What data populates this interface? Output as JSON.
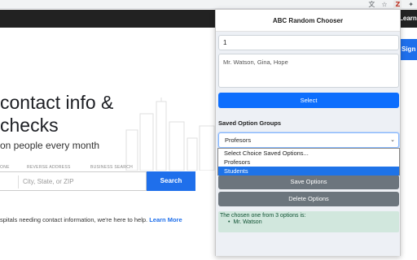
{
  "browser": {
    "translate_icon": "translate-icon",
    "star_icon": "bookmark-star-icon",
    "extension_icon": "extension-icon",
    "puzzle_icon": "extensions-puzzle-icon"
  },
  "site": {
    "nav_learn": "Learn M",
    "sign_button": "Sign",
    "hero_line1": "contact info &",
    "hero_line2": "checks",
    "hero_sub": "on people every month",
    "search_tabs": [
      "ONE",
      "REVERSE ADDRESS",
      "BUSINESS SEARCH"
    ],
    "search_placeholder": "City, State, or ZIP",
    "search_button": "Search",
    "help_text": "spitals needing contact information, we're here to help.",
    "help_link": "Learn More",
    "accent_color": "#1f6feb"
  },
  "popup": {
    "title": "ABC Random Chooser",
    "number_value": "1",
    "options_value": "Mr. Watson, Gina, Hope",
    "select_button": "Select",
    "saved_groups_label": "Saved Option Groups",
    "selected_group": "Profesors",
    "dropdown_options": [
      "Select Choice Saved Options...",
      "Profesors",
      "Students"
    ],
    "highlighted_option": "Students",
    "save_button": "Save Options",
    "delete_button": "Delete Options",
    "result_text": "The chosen one from 3 options is:",
    "result_item": "Mr. Watson",
    "colors": {
      "primary": "#0d6efd",
      "secondary": "#6c757d",
      "success_bg": "#d1e7dd",
      "success_text": "#0f5132"
    }
  }
}
